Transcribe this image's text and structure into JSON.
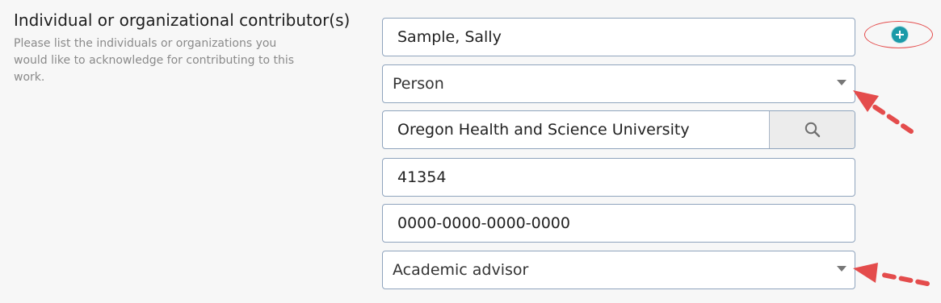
{
  "section": {
    "title": "Individual or organizational contributor(s)",
    "help": "Please list the individuals or organizations you would like to acknowledge for contributing to this work."
  },
  "form": {
    "name_value": "Sample, Sally",
    "type_selected": "Person",
    "affiliation_value": "Oregon Health and Science University",
    "id_value": "41354",
    "orcid_value": "0000-0000-0000-0000",
    "role_selected": "Academic advisor"
  },
  "icons": {
    "add": "plus-circle-icon",
    "search": "search-icon",
    "dropdown": "chevron-down-icon"
  },
  "colors": {
    "background": "#f7f7f7",
    "input_border": "#8fa4bd",
    "accent": "#1b9aa8",
    "annotation": "#e44c4c"
  }
}
